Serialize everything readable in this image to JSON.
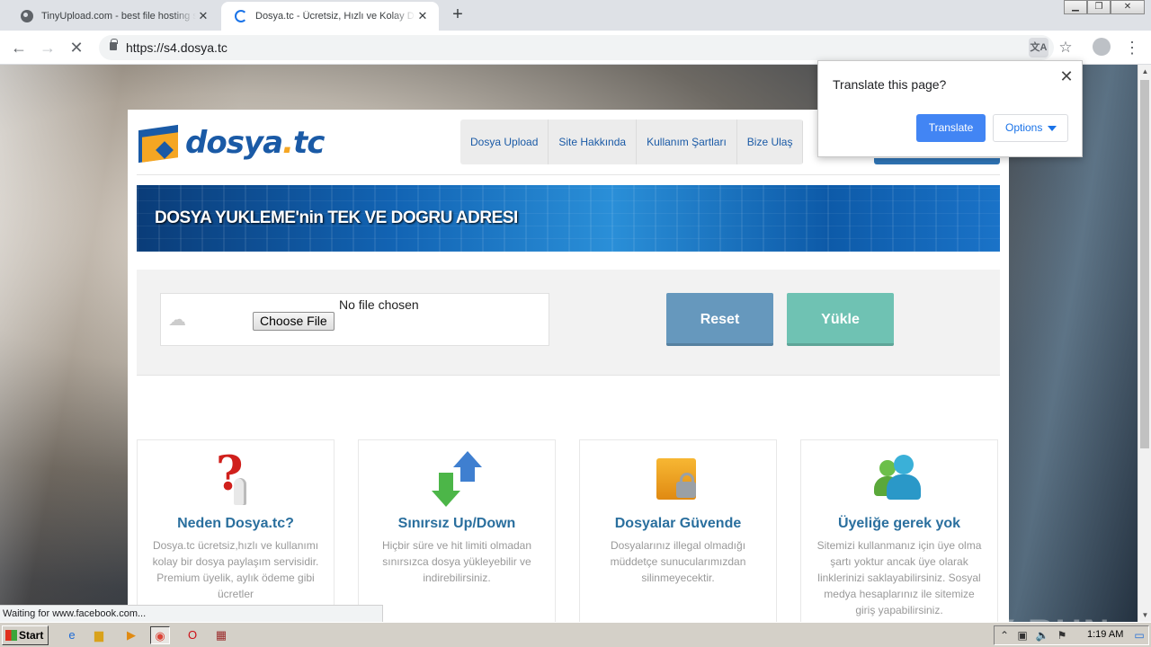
{
  "browser": {
    "tabs": [
      {
        "title": "TinyUpload.com - best file hosting so",
        "active": false,
        "icon": "globe-icon"
      },
      {
        "title": "Dosya.tc - Ücretsiz, Hızlı ve Kolay Do",
        "active": true,
        "icon": "loading-spinner-icon"
      }
    ],
    "new_tab_label": "+",
    "url": "https://s4.dosya.tc",
    "status_text": "Waiting for www.facebook.com..."
  },
  "translate_popup": {
    "question": "Translate this page?",
    "translate_label": "Translate",
    "options_label": "Options"
  },
  "site": {
    "logo_text_main": "dosya",
    "logo_text_dot": ".",
    "logo_text_tld": "tc",
    "nav": [
      "Dosya Upload",
      "Site Hakkında",
      "Kullanım Şartları",
      "Bize Ulaş"
    ],
    "banner_text": "DOSYA YUKLEME'nin TEK VE DOGRU ADRESI",
    "upload": {
      "no_file_text": "No file chosen",
      "choose_label": "Choose File",
      "reset_label": "Reset",
      "upload_label": "Yükle"
    },
    "features": [
      {
        "title": "Neden Dosya.tc?",
        "text": "Dosya.tc ücretsiz,hızlı ve kullanımı kolay bir dosya paylaşım servisidir. Premium üyelik, aylık ödeme gibi ücretler",
        "icon": "question-icon"
      },
      {
        "title": "Sınırsız Up/Down",
        "text": "Hiçbir süre ve hit limiti olmadan sınırsızca dosya yükleyebilir ve indirebilirsiniz.",
        "icon": "up-down-arrows-icon"
      },
      {
        "title": "Dosyalar Güvende",
        "text": "Dosyalarınız illegal olmadığı müddetçe sunucularımızdan silinmeyecektir.",
        "icon": "locked-folder-icon"
      },
      {
        "title": "Üyeliğe gerek yok",
        "text": "Sitemizi kullanmanız için üye olma şartı yoktur ancak üye olarak linklerinizi saklayabilirsiniz. Sosyal medya hesaplarınız ile sitemize giriş yapabilirsiniz.",
        "icon": "users-icon"
      }
    ]
  },
  "watermark": "ANY RUN",
  "taskbar": {
    "start_label": "Start",
    "clock": "1:19 AM"
  }
}
